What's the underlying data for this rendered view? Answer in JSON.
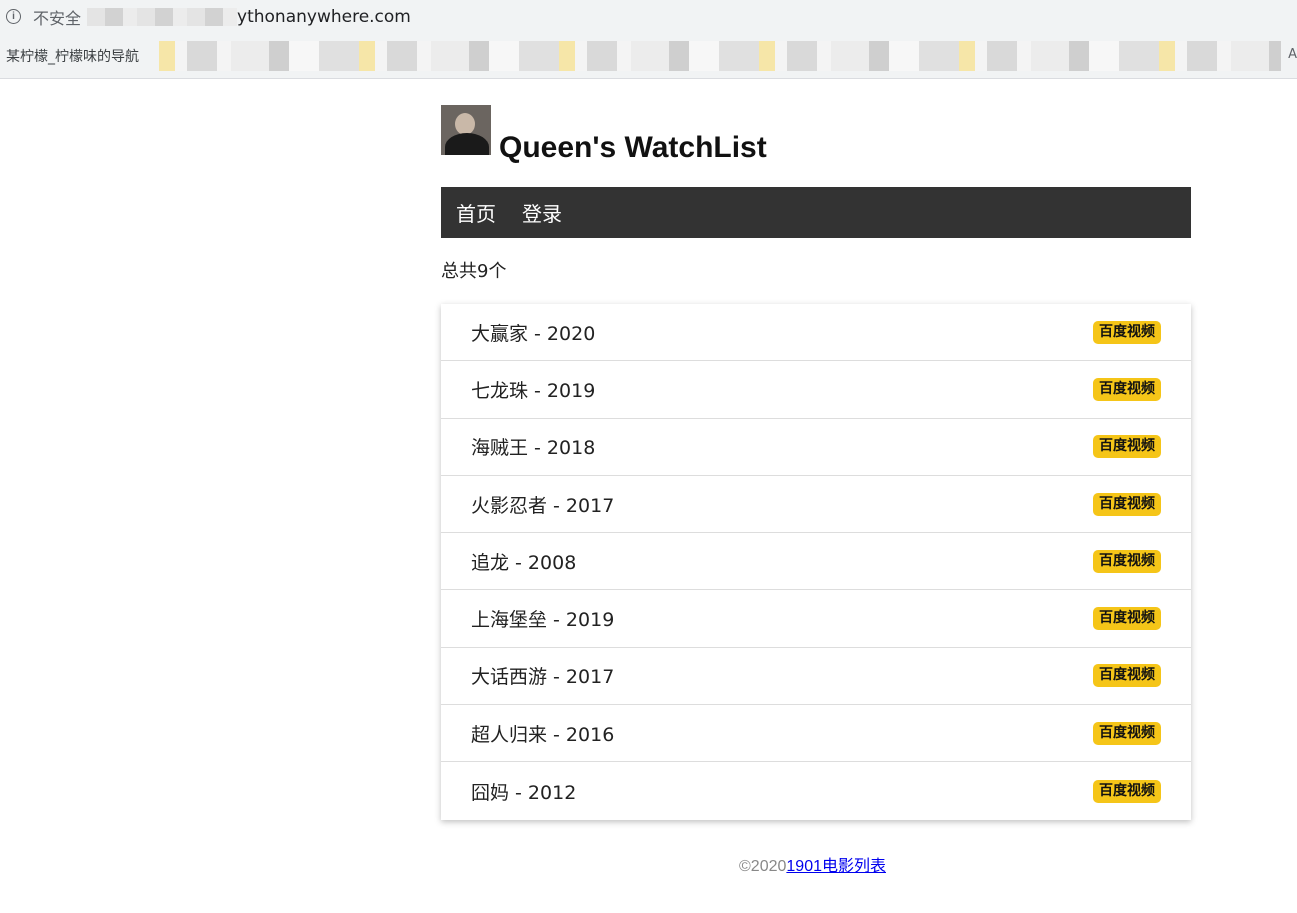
{
  "browser": {
    "insecure_label": "不安全",
    "url": "ythonanywhere.com",
    "bookmark_first": "某柠檬_柠檬味的导航",
    "bookmark_end": "A"
  },
  "header": {
    "title": "Queen's WatchList"
  },
  "nav": {
    "home": "首页",
    "login": "登录"
  },
  "count_text": "总共9个",
  "movies": [
    {
      "label": "大赢家 - 2020",
      "badge": "百度视频"
    },
    {
      "label": "七龙珠 - 2019",
      "badge": "百度视频"
    },
    {
      "label": "海贼王 - 2018",
      "badge": "百度视频"
    },
    {
      "label": "火影忍者 - 2017",
      "badge": "百度视频"
    },
    {
      "label": "追龙 - 2008",
      "badge": "百度视频"
    },
    {
      "label": "上海堡垒 - 2019",
      "badge": "百度视频"
    },
    {
      "label": "大话西游 - 2017",
      "badge": "百度视频"
    },
    {
      "label": "超人归来 - 2016",
      "badge": "百度视频"
    },
    {
      "label": "囧妈 - 2012",
      "badge": "百度视频"
    }
  ],
  "footer": {
    "copyright": "©2020",
    "link": "1901电影列表"
  }
}
